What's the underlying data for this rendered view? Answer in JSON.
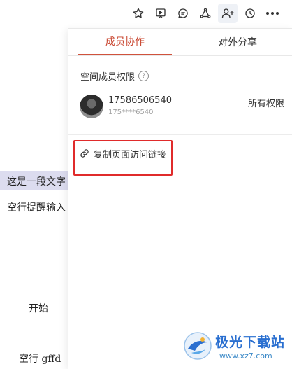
{
  "toolbar": {
    "icons": [
      "star-icon",
      "present-icon",
      "comment-icon",
      "share-node-icon",
      "add-member-icon",
      "history-icon",
      "more-icon"
    ]
  },
  "document": {
    "lines": [
      "这是一段文字",
      "空行提醒输入",
      "开始",
      "空行 gffd"
    ]
  },
  "panel": {
    "tabs": [
      {
        "label": "成员协作",
        "active": true
      },
      {
        "label": "对外分享",
        "active": false
      }
    ],
    "section_title": "空间成员权限",
    "help_glyph": "?",
    "member": {
      "name": "17586506540",
      "masked": "175****6540",
      "permission": "所有权限"
    },
    "copy_link_label": "复制页面访问链接"
  },
  "watermark": {
    "name": "极光下载站",
    "url": "www.xz7.com"
  },
  "colors": {
    "accent": "#c8442e",
    "highlight_box": "#e02b2b",
    "selection": "#dcdcef",
    "watermark": "#2a6fd0"
  }
}
